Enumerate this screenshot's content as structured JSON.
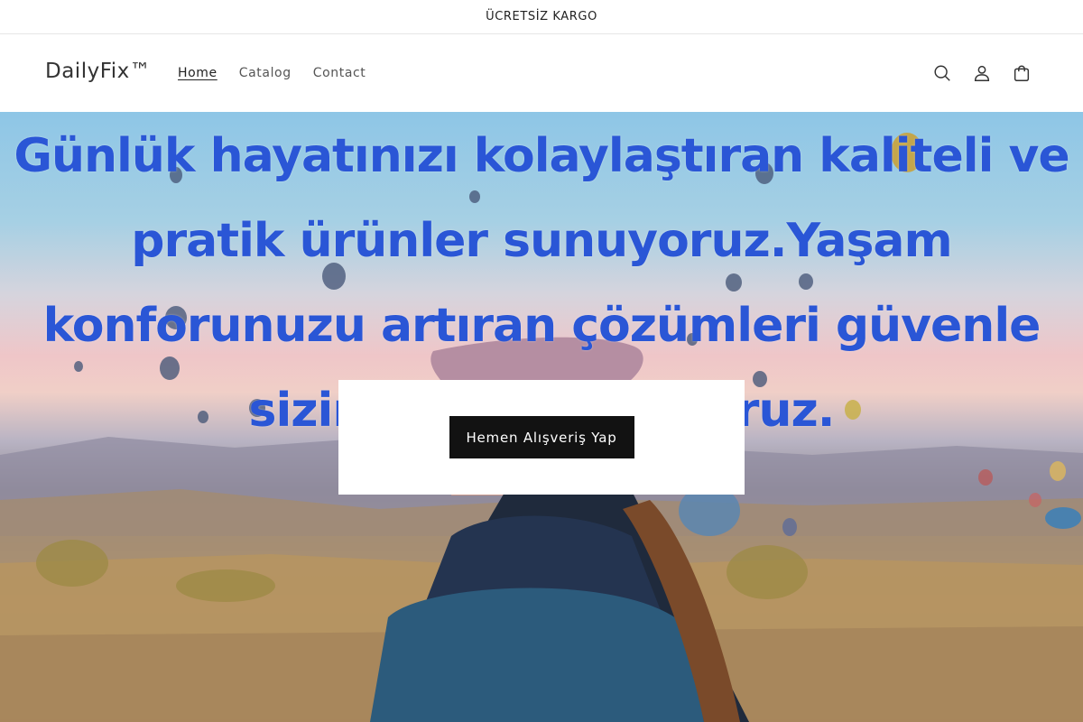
{
  "announcement": {
    "text": "ÜCRETSİZ KARGO"
  },
  "header": {
    "logo": "DailyFix™",
    "nav": [
      {
        "label": "Home"
      },
      {
        "label": "Catalog"
      },
      {
        "label": "Contact"
      }
    ],
    "icons": [
      "search-icon",
      "account-icon",
      "cart-icon"
    ]
  },
  "hero": {
    "title": "Günlük hayatınızı kolaylaştıran kaliteli ve pratik ürünler sunuyoruz.Yaşam konforunuzu artıran çözümleri güvenle sizinle buluşturuyoruz.",
    "button_label": "Hemen Alışveriş Yap",
    "colors": {
      "title": "#2a56d6",
      "button_bg": "#121212"
    }
  }
}
